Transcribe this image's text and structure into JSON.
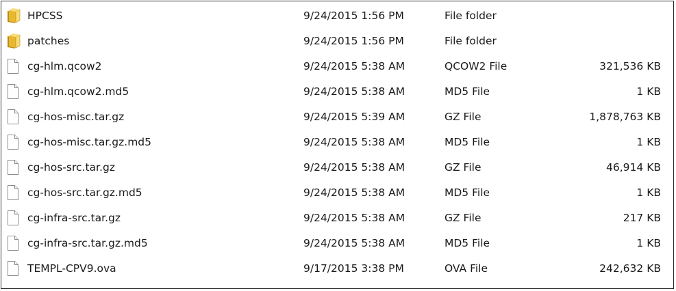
{
  "files": [
    {
      "name": "HPCSS",
      "date": "9/24/2015 1:56 PM",
      "type": "File folder",
      "size": "",
      "icon": "folder-icon"
    },
    {
      "name": "patches",
      "date": "9/24/2015 1:56 PM",
      "type": "File folder",
      "size": "",
      "icon": "folder-icon"
    },
    {
      "name": "cg-hlm.qcow2",
      "date": "9/24/2015 5:38 AM",
      "type": "QCOW2 File",
      "size": "321,536 KB",
      "icon": "file-icon"
    },
    {
      "name": "cg-hlm.qcow2.md5",
      "date": "9/24/2015 5:38 AM",
      "type": "MD5 File",
      "size": "1 KB",
      "icon": "file-icon"
    },
    {
      "name": "cg-hos-misc.tar.gz",
      "date": "9/24/2015 5:39 AM",
      "type": "GZ File",
      "size": "1,878,763 KB",
      "icon": "file-icon"
    },
    {
      "name": "cg-hos-misc.tar.gz.md5",
      "date": "9/24/2015 5:38 AM",
      "type": "MD5 File",
      "size": "1 KB",
      "icon": "file-icon"
    },
    {
      "name": "cg-hos-src.tar.gz",
      "date": "9/24/2015 5:38 AM",
      "type": "GZ File",
      "size": "46,914 KB",
      "icon": "file-icon"
    },
    {
      "name": "cg-hos-src.tar.gz.md5",
      "date": "9/24/2015 5:38 AM",
      "type": "MD5 File",
      "size": "1 KB",
      "icon": "file-icon"
    },
    {
      "name": "cg-infra-src.tar.gz",
      "date": "9/24/2015 5:38 AM",
      "type": "GZ File",
      "size": "217 KB",
      "icon": "file-icon"
    },
    {
      "name": "cg-infra-src.tar.gz.md5",
      "date": "9/24/2015 5:38 AM",
      "type": "MD5 File",
      "size": "1 KB",
      "icon": "file-icon"
    },
    {
      "name": "TEMPL-CPV9.ova",
      "date": "9/17/2015 3:38 PM",
      "type": "OVA File",
      "size": "242,632 KB",
      "icon": "file-icon"
    }
  ],
  "colors": {
    "folder_main": "#e8b830",
    "folder_light": "#f8dc78",
    "folder_dark": "#b8861a",
    "file_border": "#8c8c8c",
    "text": "#1a1a1a",
    "border": "#2b2b2b"
  }
}
